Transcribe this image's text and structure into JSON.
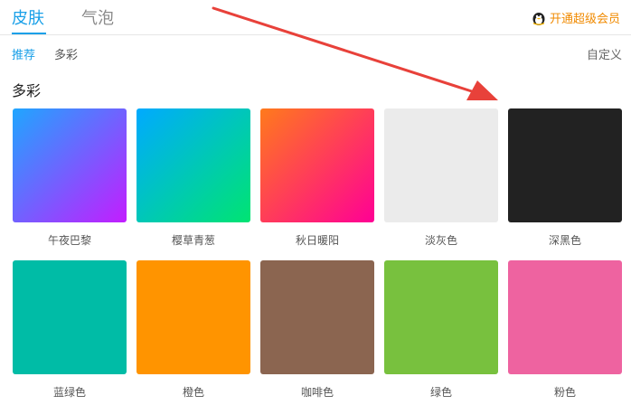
{
  "tabs": [
    {
      "label": "皮肤",
      "active": true
    },
    {
      "label": "气泡",
      "active": false
    }
  ],
  "vip_label": "开通超级会员",
  "sub_tabs": [
    {
      "label": "推荐",
      "active": true
    },
    {
      "label": "多彩",
      "active": false
    }
  ],
  "custom_label": "自定义",
  "section_title": "多彩",
  "skins": [
    {
      "label": "午夜巴黎",
      "colors": [
        "#1fa6ff",
        "#c31dff"
      ]
    },
    {
      "label": "樱草青葱",
      "colors": [
        "#00aaff",
        "#00e472"
      ]
    },
    {
      "label": "秋日暖阳",
      "colors": [
        "#ff7a1c",
        "#ff0095"
      ]
    },
    {
      "label": "淡灰色",
      "colors": [
        "#ebebeb"
      ]
    },
    {
      "label": "深黑色",
      "colors": [
        "#222222"
      ]
    },
    {
      "label": "蓝绿色",
      "colors": [
        "#00bca6"
      ]
    },
    {
      "label": "橙色",
      "colors": [
        "#ff9400"
      ]
    },
    {
      "label": "咖啡色",
      "colors": [
        "#8b6550"
      ]
    },
    {
      "label": "绿色",
      "colors": [
        "#78c13e"
      ]
    },
    {
      "label": "粉色",
      "colors": [
        "#ee63a0"
      ]
    }
  ],
  "accent_color": "#1aa0e8",
  "annotation_color": "#e8413a"
}
